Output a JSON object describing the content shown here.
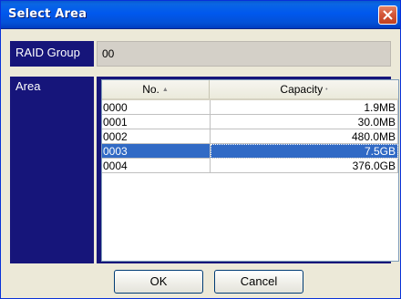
{
  "window": {
    "title": "Select Area"
  },
  "colors": {
    "title_bar": "#0058ee",
    "label_bg": "#16157a",
    "selection": "#316ac5",
    "close_button": "#d4573a",
    "dialog_bg": "#ece9d8"
  },
  "icons": {
    "close": "close-icon",
    "sort_ascending": "sort-ascending-icon",
    "sort_neutral": "sort-icon"
  },
  "raid_group": {
    "label": "RAID Group",
    "value": "00"
  },
  "area": {
    "label": "Area",
    "columns": [
      "No.",
      "Capacity"
    ],
    "sort_indicators": [
      "▲",
      "•"
    ],
    "rows": [
      {
        "no": "0000",
        "capacity": "1.9MB",
        "selected": false
      },
      {
        "no": "0001",
        "capacity": "30.0MB",
        "selected": false
      },
      {
        "no": "0002",
        "capacity": "480.0MB",
        "selected": false
      },
      {
        "no": "0003",
        "capacity": "7.5GB",
        "selected": true
      },
      {
        "no": "0004",
        "capacity": "376.0GB",
        "selected": false
      }
    ]
  },
  "buttons": {
    "ok": "OK",
    "cancel": "Cancel"
  }
}
